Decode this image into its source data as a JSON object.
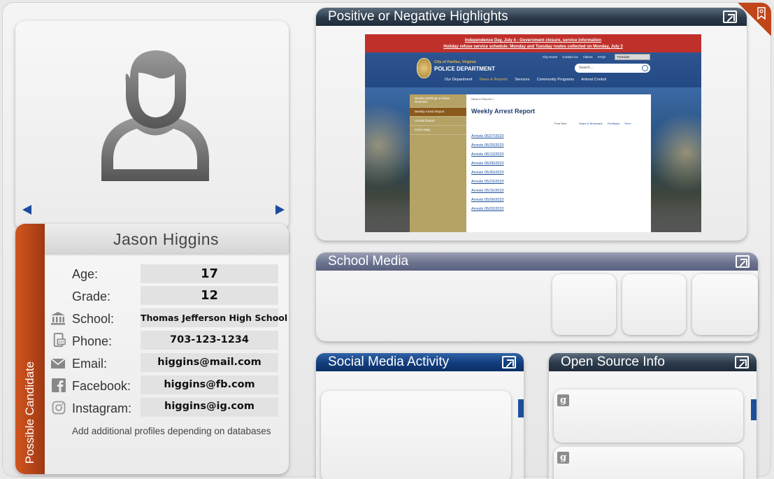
{
  "profile": {
    "name": "Jason Higgins",
    "status_label": "Possible Candidate",
    "fields": {
      "age": {
        "label": "Age:",
        "value": "17"
      },
      "grade": {
        "label": "Grade:",
        "value": "12"
      },
      "school": {
        "label": "School:",
        "value": "Thomas Jefferson High School"
      },
      "phone": {
        "label": "Phone:",
        "value": "703-123-1234"
      },
      "email": {
        "label": "Email:",
        "value": "higgins@mail.com"
      },
      "facebook": {
        "label": "Facebook:",
        "value": "higgins@fb.com"
      },
      "instagram": {
        "label": "Instagram:",
        "value": "higgins@ig.com"
      }
    },
    "note": "Add additional profiles depending on databases"
  },
  "panels": {
    "highlights": {
      "title": "Positive or Negative Highlights"
    },
    "school_media": {
      "title": "School Media"
    },
    "social_media": {
      "title": "Social Media Activity"
    },
    "open_source": {
      "title": "Open Source Info"
    }
  },
  "open_source_icons": [
    "google-icon",
    "google-icon"
  ],
  "embedded_page": {
    "alerts": [
      "Independence Day, July 4 - Government closure, service information",
      "Holiday refuse service schedule: Monday and Tuesday routes collected on Monday, July 3"
    ],
    "top_links": [
      "City Home",
      "Contact Us",
      "Videos",
      "FAQs"
    ],
    "translate_label": "Translate",
    "city_name": "City of Fairfax, Virginia",
    "department": "POLICE DEPARTMENT",
    "search_placeholder": "Search...",
    "nav": [
      "Our Department",
      "News & Reports",
      "Services",
      "Community Programs",
      "Animal Control"
    ],
    "sidebar": [
      "Weekly Briefings & News Releases",
      "Weekly Arrest Report",
      "Annual Report",
      "Crime Map"
    ],
    "breadcrumb": "News & Reports »",
    "heading": "Weekly Arrest Report",
    "tools": {
      "font_size": "Font Size:",
      "share": "Share & Bookmark",
      "feedback": "Feedback",
      "print": "Print"
    },
    "arrest_links": [
      "Arrests 06/27/2023",
      "Arrests 06/20/2023",
      "Arrests 06/13/2023",
      "Arrests 06/06/2023",
      "Arrests 05/30/2023",
      "Arrests 05/23/2023",
      "Arrests 05/16/2023",
      "Arrests 05/09/2023",
      "Arrests 05/02/2023"
    ]
  },
  "colors": {
    "accent_orange": "#b84a1a",
    "panel_dark": "#2c3b4b",
    "panel_blue": "#123d7c",
    "nav_arrow": "#1f4aa0"
  }
}
